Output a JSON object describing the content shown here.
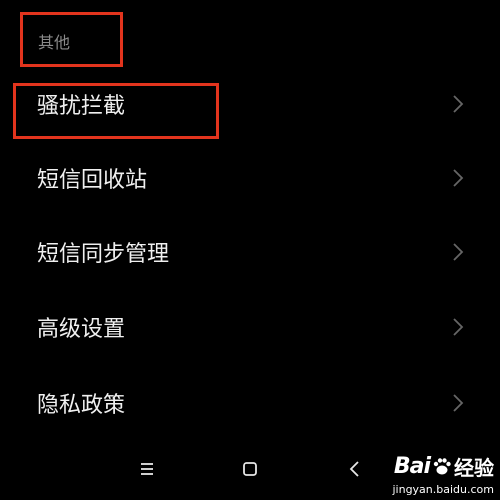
{
  "section": {
    "header": "其他"
  },
  "menu": {
    "items": [
      {
        "label": "骚扰拦截"
      },
      {
        "label": "短信回收站"
      },
      {
        "label": "短信同步管理"
      },
      {
        "label": "高级设置"
      },
      {
        "label": "隐私政策"
      }
    ]
  },
  "icons": {
    "chevron": "chevron-right-icon",
    "nav_menu": "menu-icon",
    "nav_home": "home-square-icon",
    "nav_back": "back-arrow-icon"
  },
  "colors": {
    "background": "#000000",
    "header_text": "#8a8a8a",
    "item_text": "#f0f0f0",
    "chevron": "#666666",
    "annotation": "#e2341d"
  },
  "watermark": {
    "brand_bai": "Bai",
    "brand_du": "经验",
    "url": "jingyan.baidu.com"
  }
}
